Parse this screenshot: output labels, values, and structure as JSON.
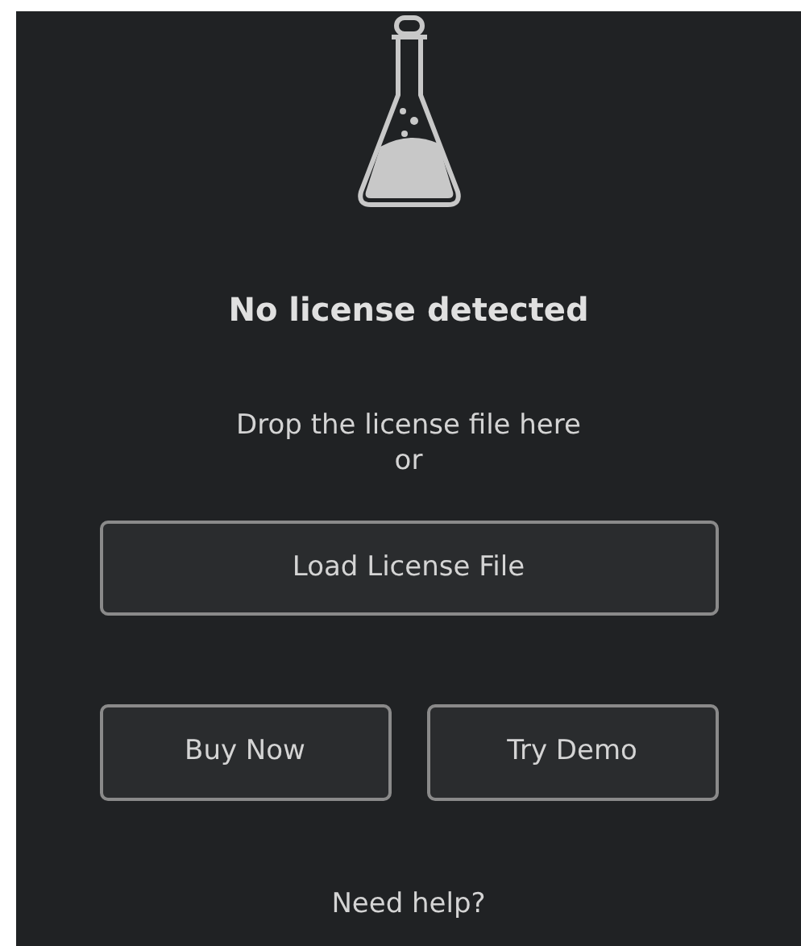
{
  "title": "No license detected",
  "drop_hint": "Drop the license file here",
  "separator": "or",
  "load_button": "Load License File",
  "buttons": [
    "Buy Now",
    "Try Demo"
  ],
  "help_link": "Need help?"
}
